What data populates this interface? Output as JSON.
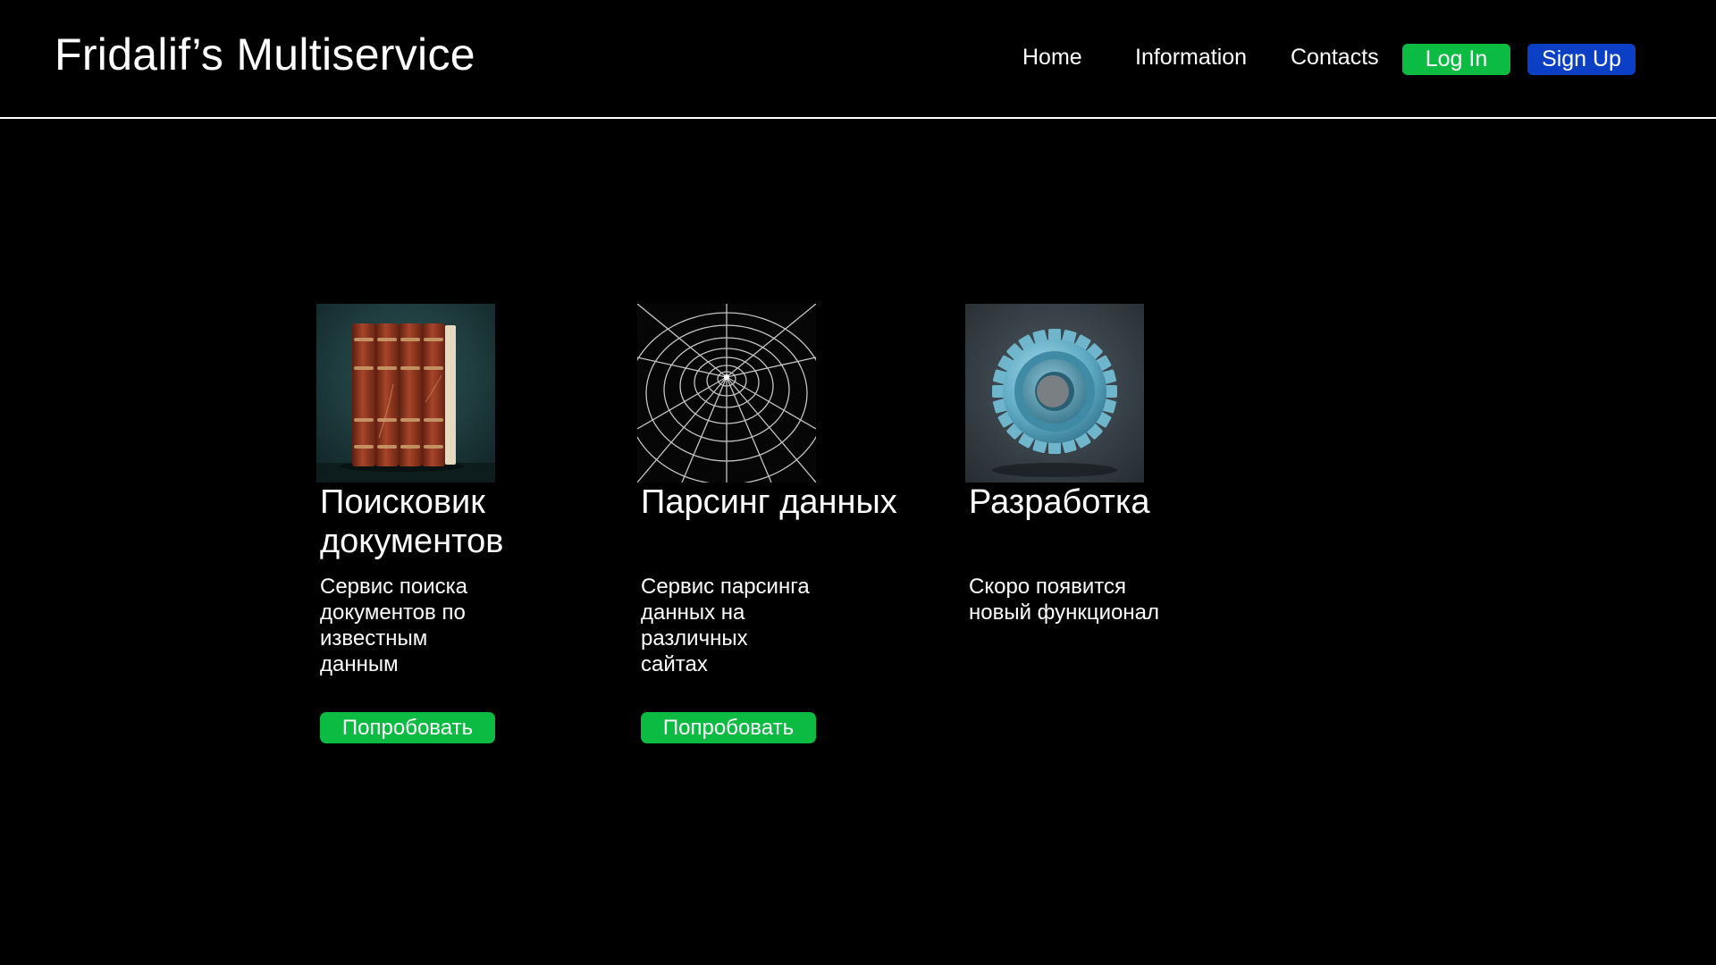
{
  "header": {
    "brand": "Fridalif’s Multiservice",
    "nav": {
      "home": "Home",
      "information": "Information",
      "contacts": "Contacts"
    },
    "login_label": "Log In",
    "signup_label": "Sign Up"
  },
  "cards": [
    {
      "title": "Поисковик документов",
      "description": "Сервис поиска документов по известным данным",
      "button_label": "Попробовать",
      "image_icon": "books-image"
    },
    {
      "title": "Парсинг данных",
      "description": "Сервис парсинга данных на различных сайтах",
      "button_label": "Попробовать",
      "image_icon": "spider-web-image"
    },
    {
      "title": "Разработка",
      "description": "Скоро появится новый функционал",
      "image_icon": "gear-image"
    }
  ],
  "colors": {
    "background": "#000000",
    "text": "#ffffff",
    "login_button": "#0cbb42",
    "signup_button": "#0b3fc6",
    "try_button": "#0cbb42",
    "divider": "#ffffff"
  }
}
